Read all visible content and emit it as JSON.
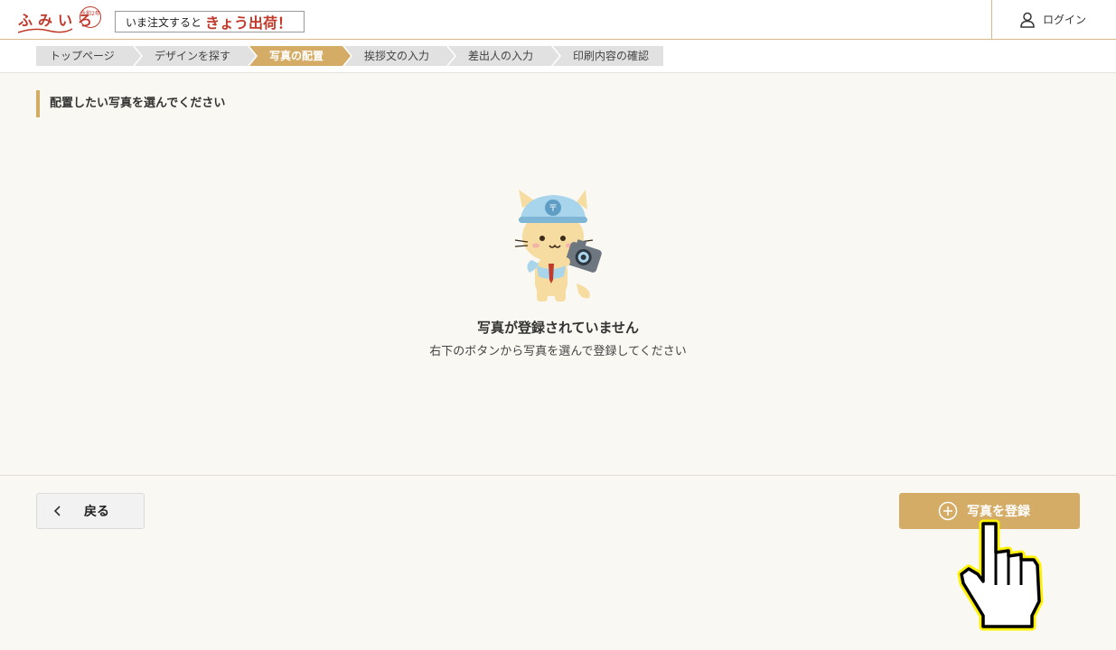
{
  "header": {
    "logo_text": "ふみいろ",
    "logo_seal_text": "令和2年",
    "promo_small": "いま注文すると",
    "promo_big": "きょう出荷！",
    "login_label": "ログイン",
    "icons": {
      "login": "user-icon"
    }
  },
  "steps": [
    {
      "label": "トップページ",
      "active": false
    },
    {
      "label": "デザインを探す",
      "active": false
    },
    {
      "label": "写真の配置",
      "active": true
    },
    {
      "label": "挨拶文の入力",
      "active": false
    },
    {
      "label": "差出人の入力",
      "active": false
    },
    {
      "label": "印刷内容の確認",
      "active": false
    }
  ],
  "section_title": "配置したい写真を選んでください",
  "empty_state": {
    "title": "写真が登録されていません",
    "subtitle": "右下のボタンから写真を選んで登録してください",
    "illustration": "cat-mascot-with-camera"
  },
  "footer": {
    "back_label": "戻る",
    "register_label": "写真を登録",
    "icons": {
      "back": "chevron-left-icon",
      "register": "plus-circle-icon"
    }
  },
  "colors": {
    "accent": "#d5ac66",
    "brand_red": "#c0392b",
    "background": "#faf8f3",
    "step_inactive": "#e1e1e1"
  }
}
